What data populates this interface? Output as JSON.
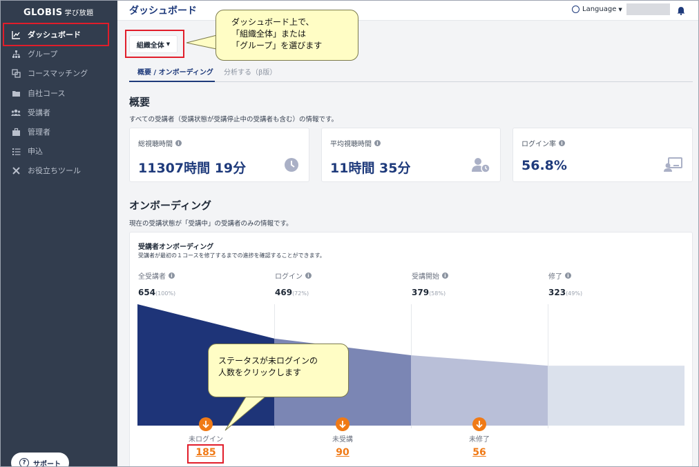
{
  "sidebar": {
    "logo": "GLOBIS",
    "logo_sub": "学び放題",
    "items": [
      {
        "label": "ダッシュボード",
        "icon": "chart-line-icon"
      },
      {
        "label": "グループ",
        "icon": "hierarchy-icon"
      },
      {
        "label": "コースマッチング",
        "icon": "course-match-icon"
      },
      {
        "label": "自社コース",
        "icon": "folder-icon"
      },
      {
        "label": "受講者",
        "icon": "users-icon"
      },
      {
        "label": "管理者",
        "icon": "briefcase-icon"
      },
      {
        "label": "申込",
        "icon": "list-icon"
      },
      {
        "label": "お役立ちツール",
        "icon": "tools-icon"
      }
    ],
    "support": "サポート"
  },
  "header": {
    "title": "ダッシュボード",
    "language": "Language"
  },
  "org_select": "組織全体",
  "tabs": {
    "overview": "概要 / オンボーディング",
    "analysis": "分析する（β版）"
  },
  "overview": {
    "title": "概要",
    "desc": "すべての受講者（受講状態が受講停止中の受講者も含む）の情報です。",
    "cards": [
      {
        "label": "総視聴時間",
        "value": "11307時間 19分"
      },
      {
        "label": "平均視聴時間",
        "value": "11時間 35分"
      },
      {
        "label": "ログイン率",
        "value": "56.8%"
      }
    ]
  },
  "onboarding": {
    "title": "オンボーディング",
    "desc": "現在の受講状態が「受講中」の受講者のみの情報です。",
    "panel_title": "受講者オンボーディング",
    "panel_desc": "受講者が最初の１コースを修了するまでの進捗を確認することができます。",
    "stages": [
      {
        "label": "全受講者",
        "value": "654",
        "pct": "(100%)"
      },
      {
        "label": "ログイン",
        "value": "469",
        "pct": "(72%)"
      },
      {
        "label": "受講開始",
        "value": "379",
        "pct": "(58%)"
      },
      {
        "label": "修了",
        "value": "323",
        "pct": "(49%)"
      }
    ],
    "drops": [
      {
        "label": "未ログイン",
        "value": "185"
      },
      {
        "label": "未受講",
        "value": "90"
      },
      {
        "label": "未修了",
        "value": "56"
      }
    ]
  },
  "chart_data": {
    "type": "area",
    "categories": [
      "全受講者",
      "ログイン",
      "受講開始",
      "修了"
    ],
    "values": [
      654,
      469,
      379,
      323
    ],
    "ylim": [
      0,
      654
    ],
    "colors": [
      "#1e3478",
      "#7b86b4",
      "#b9bfd8",
      "#dbe1ec"
    ]
  },
  "callouts": {
    "top": "ダッシュボード上で、\n「組織全体」または\n「グループ」を選びます",
    "bottom": "ステータスが未ログインの\n人数をクリックします"
  }
}
